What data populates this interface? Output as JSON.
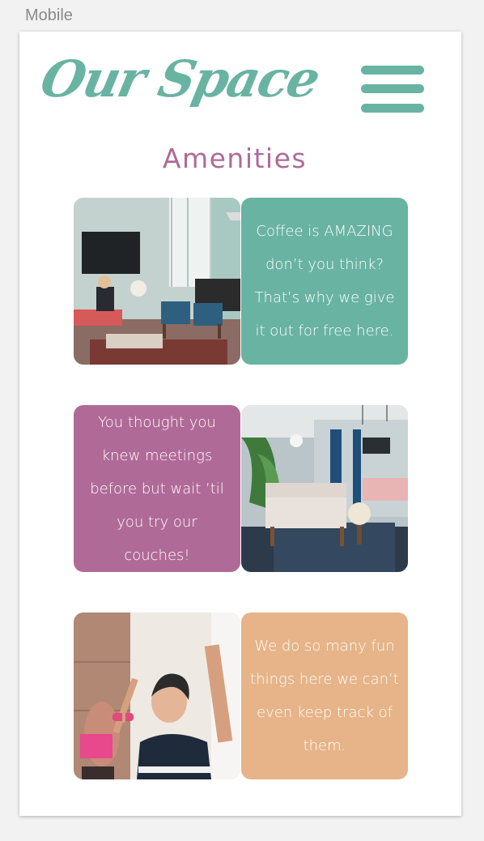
{
  "artboard": {
    "label": "Mobile"
  },
  "header": {
    "logo_text": "Our Space",
    "menu_icon": "hamburger-menu-icon"
  },
  "section": {
    "title": "Amenities"
  },
  "amenities": [
    {
      "text": "Coffee is AMAZING don’t you think? That’s why we give it out for free here.",
      "color": "#69b3a2",
      "photo": "lounge-photo"
    },
    {
      "text": "You thought you knew meetings before but wait ’til you try our couches!",
      "color": "#b06a98",
      "photo": "couch-photo"
    },
    {
      "text": "We do so many fun things here we can’t even keep track of them.",
      "color": "#e6b488",
      "photo": "fitness-photo"
    }
  ],
  "colors": {
    "brand_teal": "#69b3a2",
    "brand_purple": "#b06a98",
    "brand_peach": "#e6b488"
  }
}
